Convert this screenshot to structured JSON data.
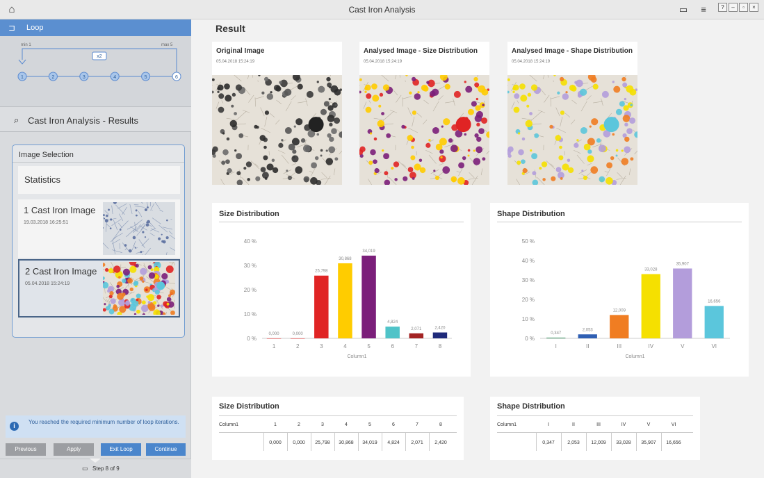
{
  "app": {
    "title": "Cast Iron Analysis"
  },
  "sidebar": {
    "loop": {
      "label": "Loop",
      "min_label": "min 1",
      "max_label": "max 5",
      "repeat_badge": "x2",
      "steps": [
        "1",
        "2",
        "3",
        "4",
        "5",
        "6"
      ]
    },
    "results_header": "Cast Iron Analysis - Results",
    "image_selection": {
      "heading": "Image Selection",
      "statistics_label": "Statistics",
      "items": [
        {
          "name": "1 Cast Iron Image",
          "date": "19.03.2018 16:25:51"
        },
        {
          "name": "2 Cast Iron Image",
          "date": "05.04.2018 15:24:19"
        }
      ]
    },
    "info_message": "You reached the required minimum number of loop iterations.",
    "buttons": {
      "previous": "Previous",
      "apply": "Apply",
      "exit_loop": "Exit Loop",
      "continue": "Continue"
    },
    "step_indicator": "Step 8 of 9"
  },
  "main": {
    "title": "Result",
    "images": [
      {
        "title": "Original Image",
        "date": "05.04.2018 15:24:19"
      },
      {
        "title": "Analysed Image - Size Distribution",
        "date": "05.04.2018 15:24:19"
      },
      {
        "title": "Analysed Image - Shape Distribution",
        "date": "05.04.2018 15:24:19"
      }
    ],
    "size_table": {
      "title": "Size Distribution",
      "row_header": "Column1",
      "columns": [
        "1",
        "2",
        "3",
        "4",
        "5",
        "6",
        "7",
        "8"
      ],
      "values": [
        "0,000",
        "0,000",
        "25,798",
        "30,868",
        "34,019",
        "4,824",
        "2,071",
        "2,420"
      ]
    },
    "shape_table": {
      "title": "Shape Distribution",
      "row_header": "Column1",
      "columns": [
        "I",
        "II",
        "III",
        "IV",
        "V",
        "VI"
      ],
      "values": [
        "0,347",
        "2,053",
        "12,009",
        "33,028",
        "35,907",
        "16,656"
      ]
    }
  },
  "chart_data": [
    {
      "type": "bar",
      "title": "Size Distribution",
      "xlabel": "Column1",
      "ylabel": "",
      "categories": [
        "1",
        "2",
        "3",
        "4",
        "5",
        "6",
        "7",
        "8"
      ],
      "values": [
        0.0,
        0.0,
        25.798,
        30.868,
        34.019,
        4.824,
        2.071,
        2.42
      ],
      "data_labels": [
        "0,000",
        "0,000",
        "25,798",
        "30,868",
        "34,019",
        "4,824",
        "2,071",
        "2,420"
      ],
      "colors": [
        "#e02424",
        "#e02424",
        "#e02424",
        "#ffcc00",
        "#7b1f7a",
        "#4fc3c8",
        "#a32323",
        "#1f2a7a"
      ],
      "yticks": [
        "0 %",
        "10 %",
        "20 %",
        "30 %",
        "40 %"
      ],
      "ylim": [
        0,
        40
      ],
      "grid": false
    },
    {
      "type": "bar",
      "title": "Shape Distribution",
      "xlabel": "Column1",
      "ylabel": "",
      "categories": [
        "I",
        "II",
        "III",
        "IV",
        "V",
        "VI"
      ],
      "values": [
        0.347,
        2.053,
        12.009,
        33.028,
        35.907,
        16.656
      ],
      "data_labels": [
        "0,347",
        "2,053",
        "12,009",
        "33,028",
        "35,907",
        "16,656"
      ],
      "colors": [
        "#2e8b57",
        "#2f5fb3",
        "#f07d22",
        "#f5e000",
        "#b39ddb",
        "#5bc6dc"
      ],
      "yticks": [
        "0 %",
        "10 %",
        "20 %",
        "30 %",
        "40 %",
        "50 %"
      ],
      "ylim": [
        0,
        50
      ],
      "grid": false
    }
  ]
}
